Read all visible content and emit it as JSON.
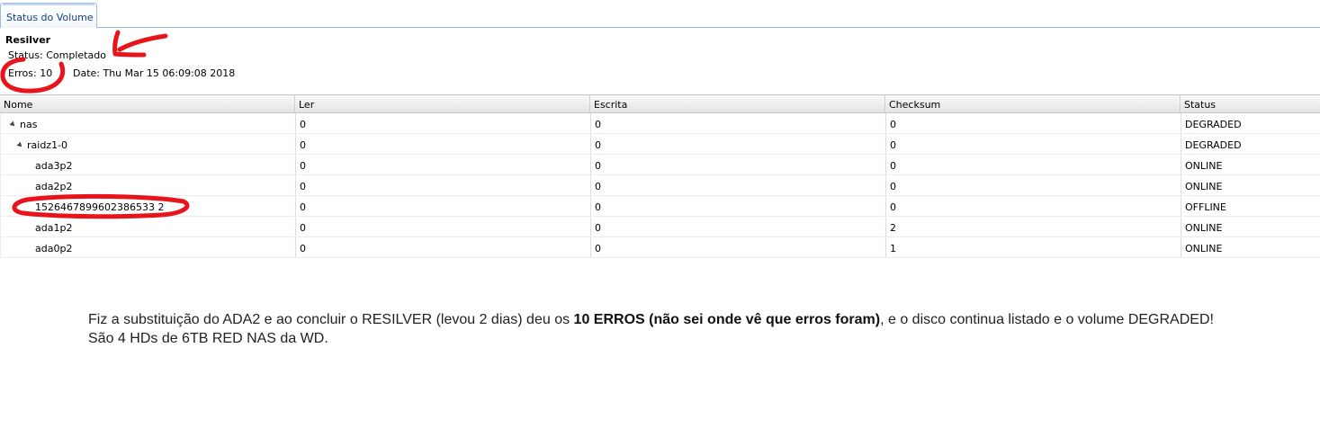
{
  "tabs": [
    {
      "label": "Status do Volume"
    }
  ],
  "resilver": {
    "title": "Resilver",
    "status": "Status: Completado",
    "errors": "Erros: 10",
    "date": "Date: Thu Mar 15 06:09:08 2018"
  },
  "grid": {
    "columns": [
      "Nome",
      "Ler",
      "Escrita",
      "Checksum",
      "Status"
    ],
    "rows": [
      {
        "name": "nas",
        "read": "0",
        "write": "0",
        "checksum": "0",
        "status": "DEGRADED"
      },
      {
        "name": "raidz1-0",
        "read": "0",
        "write": "0",
        "checksum": "0",
        "status": "DEGRADED"
      },
      {
        "name": "ada3p2",
        "read": "0",
        "write": "0",
        "checksum": "0",
        "status": "ONLINE"
      },
      {
        "name": "ada2p2",
        "read": "0",
        "write": "0",
        "checksum": "0",
        "status": "ONLINE"
      },
      {
        "name": "1526467899602386533 2",
        "read": "0",
        "write": "0",
        "checksum": "0",
        "status": "OFFLINE"
      },
      {
        "name": "ada1p2",
        "read": "0",
        "write": "0",
        "checksum": "2",
        "status": "ONLINE"
      },
      {
        "name": "ada0p2",
        "read": "0",
        "write": "0",
        "checksum": "1",
        "status": "ONLINE"
      }
    ]
  },
  "message": {
    "part1": "Fiz a substituição do ADA2 e ao concluir o RESILVER (levou 2 dias) deu os ",
    "bold": "10 ERROS (não sei onde vê que erros foram)",
    "part2": ", e o disco continua listado e o volume DEGRADED!",
    "line2": "São 4 HDs de 6TB RED NAS da WD."
  },
  "annotation_color": "#e8141b"
}
